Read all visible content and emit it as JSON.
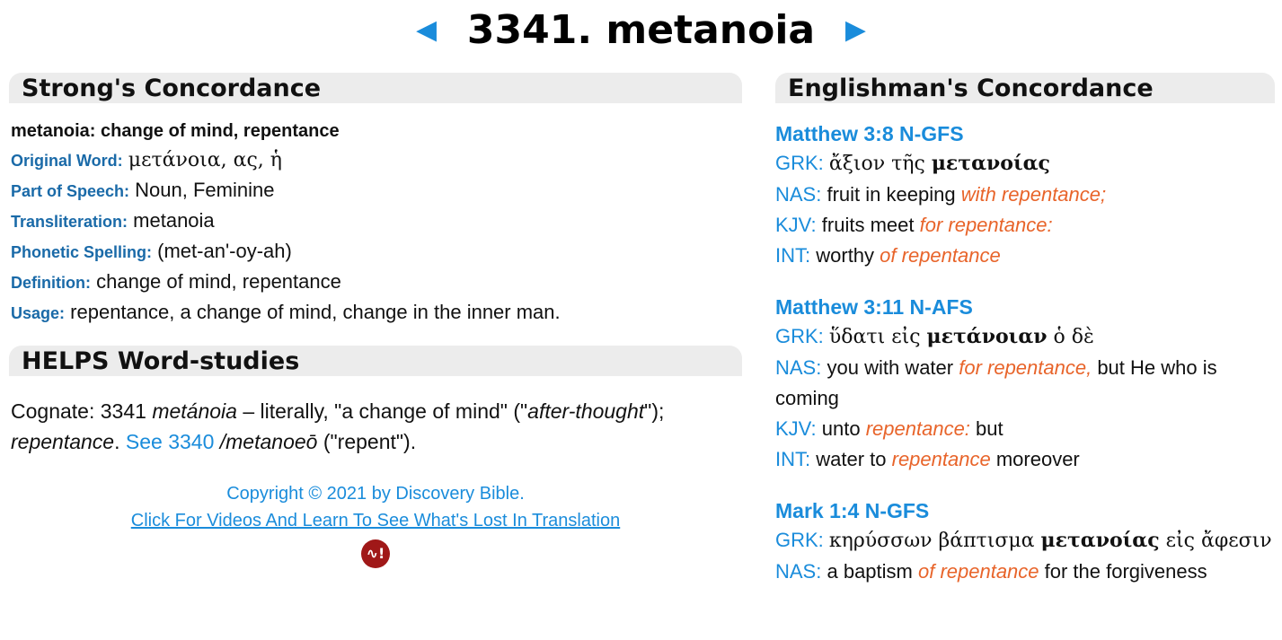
{
  "header": {
    "prev_arrow": "◄",
    "title": "3341. metanoia",
    "next_arrow": "►"
  },
  "strongs": {
    "heading": "Strong's Concordance",
    "summary": "metanoia: change of mind, repentance",
    "original_word_label": "Original Word:",
    "original_word": "μετάνοια, ας, ἡ",
    "part_of_speech_label": "Part of Speech:",
    "part_of_speech": "Noun, Feminine",
    "transliteration_label": "Transliteration:",
    "transliteration": "metanoia",
    "phonetic_label": "Phonetic Spelling:",
    "phonetic": "(met-an'-oy-ah)",
    "definition_label": "Definition:",
    "definition": "change of mind, repentance",
    "usage_label": "Usage:",
    "usage": "repentance, a change of mind, change in the inner man."
  },
  "helps": {
    "heading": "HELPS Word-studies",
    "cognate_label": "Cognate:",
    "cognate_num": "3341",
    "cognate_word": "metánoia",
    "text1": " – literally, \"a change of mind\" (\"",
    "after_thought": "after-thought",
    "text2": "\");",
    "repentance": "repentance",
    "text3": ". ",
    "see_link": "See 3340",
    "text4": " ",
    "metanoeo": "/metanoeō",
    "text5": " (\"repent\")."
  },
  "footer": {
    "copyright": "Copyright © 2021 by Discovery Bible.",
    "link": "Click For Videos And Learn To See What's Lost In Translation",
    "logo_text": "∿!"
  },
  "englishmans": {
    "heading": "Englishman's Concordance",
    "entries": [
      {
        "ref": "Matthew 3:8 N-GFS",
        "grk_label": "GRK:",
        "grk_pre": "ἄξιον τῆς ",
        "grk_bold": "μετανοίας",
        "grk_post": "",
        "nas_label": "NAS:",
        "nas_pre": "fruit in keeping ",
        "nas_hl": "with repentance;",
        "nas_post": "",
        "kjv_label": "KJV:",
        "kjv_pre": "fruits meet ",
        "kjv_hl": "for repentance:",
        "kjv_post": "",
        "int_label": "INT:",
        "int_pre": "worthy ",
        "int_hl": "of repentance",
        "int_post": ""
      },
      {
        "ref": "Matthew 3:11 N-AFS",
        "grk_label": "GRK:",
        "grk_pre": "ὕδατι εἰς ",
        "grk_bold": "μετάνοιαν",
        "grk_post": " ὁ δὲ",
        "nas_label": "NAS:",
        "nas_pre": "you with water ",
        "nas_hl": "for repentance,",
        "nas_post": " but He who is coming",
        "kjv_label": "KJV:",
        "kjv_pre": "unto ",
        "kjv_hl": "repentance:",
        "kjv_post": " but",
        "int_label": "INT:",
        "int_pre": "water to ",
        "int_hl": "repentance",
        "int_post": " moreover"
      },
      {
        "ref": "Mark 1:4 N-GFS",
        "grk_label": "GRK:",
        "grk_pre": "κηρύσσων βάπτισμα ",
        "grk_bold": "μετανοίας",
        "grk_post": " εἰς ἄφεσιν",
        "nas_label": "NAS:",
        "nas_pre": "a baptism ",
        "nas_hl": "of repentance",
        "nas_post": " for the forgiveness"
      }
    ]
  }
}
